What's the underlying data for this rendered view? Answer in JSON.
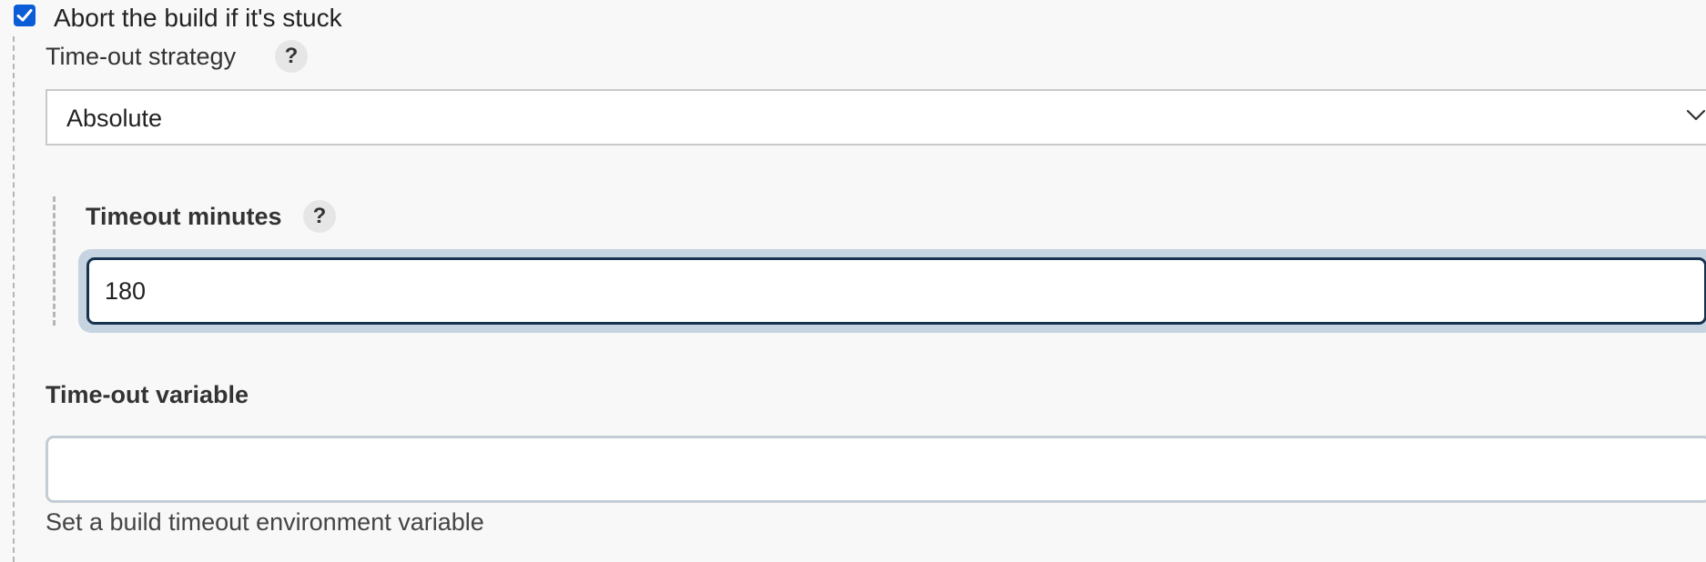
{
  "abort_option": {
    "checked": true,
    "label": "Abort the build if it's stuck"
  },
  "timeout_strategy": {
    "label": "Time-out strategy",
    "help_glyph": "?",
    "selected_value": "Absolute"
  },
  "timeout_minutes": {
    "label": "Timeout minutes",
    "help_glyph": "?",
    "value": "180"
  },
  "timeout_variable": {
    "label": "Time-out variable",
    "value": "",
    "description": "Set a build timeout environment variable"
  },
  "colors": {
    "checkbox": "#0b5cd7",
    "focus_border": "#16324f",
    "focus_ring": "#c6d3e1"
  },
  "icons": {
    "checkbox": "checkmark-icon",
    "select": "chevron-down-icon",
    "help": "help-icon"
  }
}
